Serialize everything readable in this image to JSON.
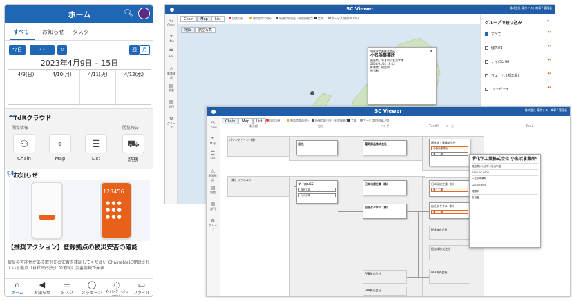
{
  "phone": {
    "header": {
      "title": "ホーム",
      "avatar": "I"
    },
    "tabs": [
      "すべて",
      "お知らせ",
      "タスク"
    ],
    "toolbar": {
      "today": "今日",
      "prev_next": "‹  ›",
      "refresh": "↻",
      "week": "週",
      "month": "月"
    },
    "range": "2023年4月9日 – 15日",
    "calendar": {
      "days": [
        "4/9(日)",
        "4/10(月)",
        "4/11(火)",
        "4/12(水)"
      ]
    },
    "tdr": {
      "title": "TdRクラウド",
      "section_left": "閲覧情報",
      "section_right": "閲覧報告",
      "items": [
        {
          "label": "Chain",
          "icon": "chain-icon"
        },
        {
          "label": "Map",
          "icon": "map-icon"
        },
        {
          "label": "List",
          "icon": "list-icon"
        },
        {
          "label": "納期",
          "icon": "truck-icon"
        }
      ]
    },
    "news": {
      "title": "お知らせ",
      "keypad_number": "123456",
      "headline": "【推奨アクション】登録拠点の被災安否の確認",
      "body": "被災の可能性がある取引先の安否を確認してください Chainableに登録されている拠点（自社/取引先）の地域に災害情報が発表"
    },
    "nav": [
      {
        "label": "ホーム",
        "icon": "home-icon"
      },
      {
        "label": "お知らせ",
        "icon": "megaphone-icon"
      },
      {
        "label": "タスク",
        "icon": "tasks-icon"
      },
      {
        "label": "メッセージ",
        "icon": "chat-icon"
      },
      {
        "label": "ダイレクトメッセージ",
        "icon": "dm-icon"
      },
      {
        "label": "ファイル",
        "icon": "folder-icon"
      }
    ]
  },
  "viewer1": {
    "title": "SC Viewer",
    "org": "株式会社 東京テスト商事 / 管理者",
    "side": [
      {
        "label": "Chain",
        "icon": "chain-icon"
      },
      {
        "label": "Map",
        "icon": "map-icon"
      },
      {
        "label": "List",
        "icon": "list-icon"
      },
      {
        "label": "影響確認",
        "icon": "alert-icon"
      },
      {
        "label": "調査",
        "icon": "survey-icon"
      },
      {
        "label": "部門",
        "icon": "building-icon"
      },
      {
        "label": "グループ",
        "icon": "group-icon"
      }
    ],
    "tabs": [
      "Chain",
      "Map",
      "List"
    ],
    "legend": [
      "自然災害",
      "感染症等の流行",
      "新規の取引先（未登録拠点）",
      "工場",
      "サービス提供(BCP等)"
    ],
    "map_tabs": [
      "地図",
      "航空写真"
    ],
    "popup": {
      "name": "小名浜事業所",
      "company": "堺化学工業株式会社",
      "address": "福島県いわき市小名浜字渚",
      "updated": "2023/04/05 15:54",
      "note": "影響度：確認中",
      "contact": "担当者"
    },
    "groups": {
      "title": "グループで絞り込み",
      "items": [
        {
          "label": "すべて",
          "checked": true
        },
        {
          "label": "優先01",
          "checked": false
        },
        {
          "label": "ナイロン66",
          "checked": false
        },
        {
          "label": "ウェーハ (新工場)",
          "checked": false
        },
        {
          "label": "コンデンサ",
          "checked": false
        }
      ]
    }
  },
  "viewer2": {
    "title": "SC Viewer",
    "org": "株式会社 東京テスト商事 / 管理者",
    "tabs": [
      "Chain",
      "Map",
      "List"
    ],
    "columns": [
      "最大顧",
      "自社",
      "ベンダー",
      "Tier 0/1",
      "メーカー",
      "Tier 2"
    ],
    "nodes": {
      "customer1": "パワレデザイン（株）",
      "customer2": "（株）プラネルク",
      "self1": "自社",
      "self2": "ナイロン66",
      "self3": "自社工場",
      "self4": "九州工場",
      "vendor1": "電気部品株式会社",
      "vendor2": "日本化成工業（株）",
      "vendor3": "自社ダクタル（株）",
      "vendor4": "FAB株式会社",
      "vendor5": "FAB株式会社",
      "maker1": "堺化学工業株式会社",
      "maker2": "日本化成工業（株）",
      "maker3": "自社ダクタル（株）",
      "maker4": "FAB株式会社",
      "maker5": "旭化成株式会社",
      "maker6": "FAB株式会社",
      "tag_hl": "小名浜事業所",
      "tag_plain": "第二工場"
    },
    "popup": {
      "name": "堺化学工業株式会社 小名浜事業所",
      "address": "福島県いわき市小名浜字渚",
      "phone": "0246-00-0000",
      "group": "小名浜事業所",
      "updated": "2023/04/05",
      "note": "確認中",
      "contact": "担当者"
    }
  }
}
